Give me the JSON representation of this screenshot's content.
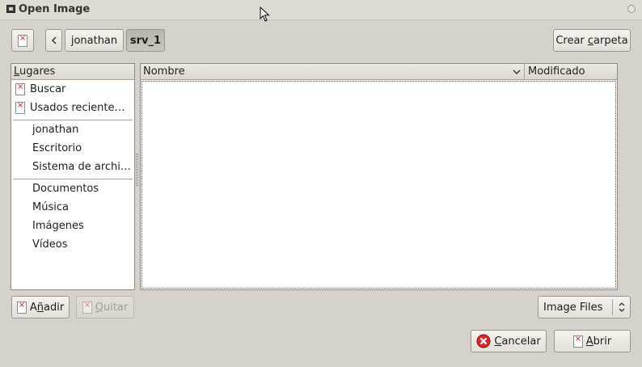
{
  "window": {
    "title": "Open Image"
  },
  "pathbar": {
    "segments": [
      {
        "label": "jonathan",
        "active": false
      },
      {
        "label": "srv_1",
        "active": true
      }
    ]
  },
  "create_folder": {
    "label_pre": "Crear ",
    "label_u": "c",
    "label_post": "arpeta"
  },
  "places": {
    "header_u": "L",
    "header_rest": "ugares",
    "group1": [
      "Buscar",
      "Usados reciente…"
    ],
    "group2": [
      "jonathan",
      "Escritorio",
      "Sistema de archi…"
    ],
    "group3": [
      "Documentos",
      "Música",
      "Imágenes",
      "Vídeos"
    ]
  },
  "files": {
    "columns": {
      "name": "Nombre",
      "modified": "Modificado"
    }
  },
  "add_button": {
    "label_pre": "A",
    "label_u": "ñ",
    "label_post": "adir"
  },
  "remove_button": {
    "label_u": "Q",
    "label_post": "uitar"
  },
  "filter": {
    "selected": "Image Files"
  },
  "actions": {
    "cancel": {
      "label_u": "C",
      "label_post": "ancelar"
    },
    "open": {
      "label_u": "A",
      "label_post": "brir"
    }
  }
}
